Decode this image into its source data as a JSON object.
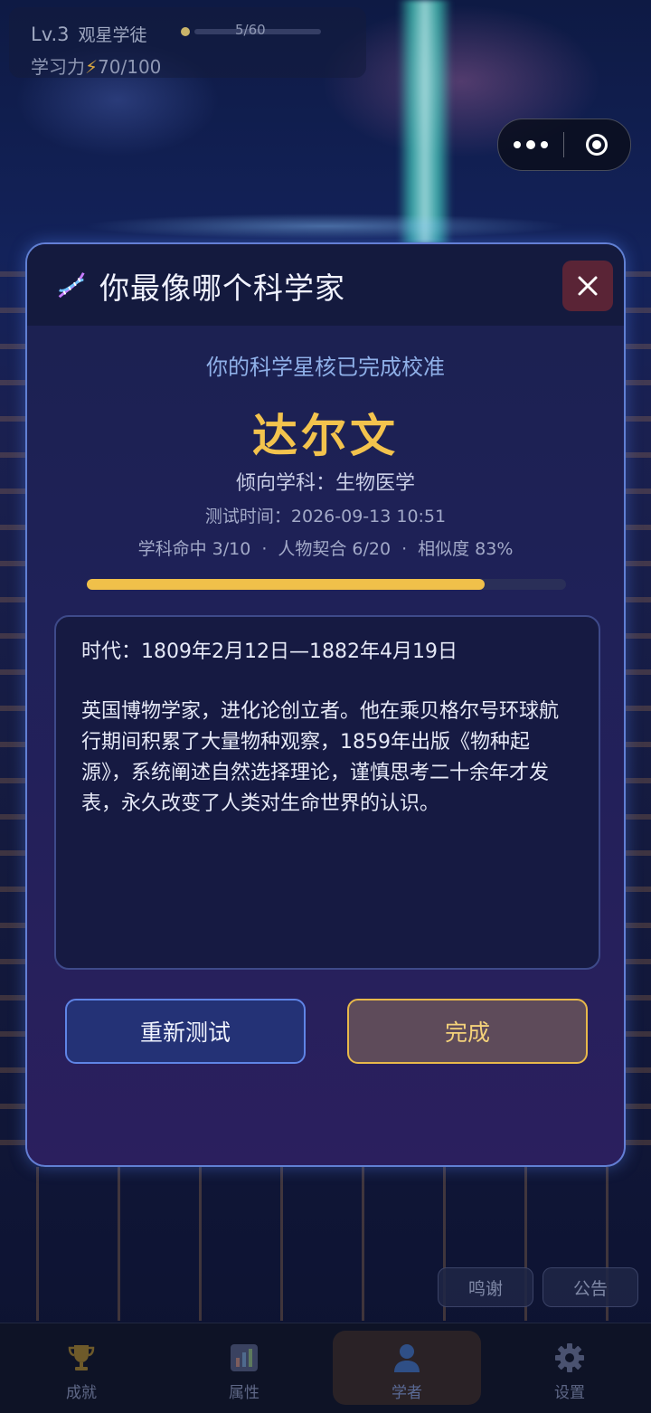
{
  "status": {
    "level": "Lv.3",
    "level_title": "观星学徒",
    "exp_text": "5/60",
    "study_label": "学习力",
    "study_bolt": "⚡",
    "study_value": "70/100"
  },
  "capsule": {
    "more_icon": "more-dots-icon",
    "target_icon": "target-icon"
  },
  "modal": {
    "title": "你最像哪个科学家",
    "header_icon": "dna-icon",
    "close_icon": "close-icon",
    "subtitle": "你的科学星核已完成校准",
    "scientist_name": "达尔文",
    "subject": "倾向学科：生物医学",
    "test_time": "测试时间：2026-09-13 10:51",
    "stats": {
      "subject_hit": "学科命中 3/10",
      "dot1": "·",
      "person_match": "人物契合 6/20",
      "dot2": "·",
      "similarity": "相似度 83%"
    },
    "similarity_fraction": 0.83,
    "era": "时代：1809年2月12日—1882年4月19日",
    "bio": "英国博物学家，进化论创立者。他在乘贝格尔号环球航行期间积累了大量物种观察，1859年出版《物种起源》，系统阐述自然选择理论，谨慎思考二十余年才发表，永久改变了人类对生命世界的认识。",
    "retest_label": "重新测试",
    "done_label": "完成"
  },
  "side_buttons": {
    "thanks": "鸣谢",
    "notice": "公告"
  },
  "tabbar": {
    "achievements": "成就",
    "attributes": "属性",
    "scholar": "学者",
    "settings": "设置"
  },
  "colors": {
    "accent_gold": "#f3c34d",
    "modal_border": "#5f84e6",
    "close_bg": "#5a2436"
  }
}
